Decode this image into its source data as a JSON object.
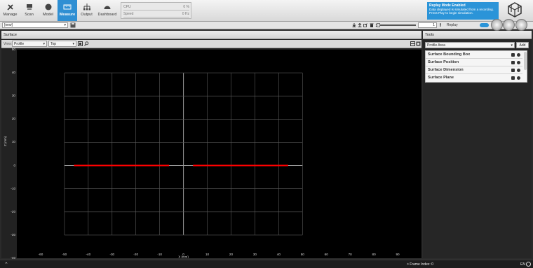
{
  "nav": [
    {
      "label": "Manage",
      "icon": "tools-icon"
    },
    {
      "label": "Scan",
      "icon": "scan-icon"
    },
    {
      "label": "Model",
      "icon": "model-icon"
    },
    {
      "label": "Measure",
      "icon": "measure-icon",
      "active": true
    },
    {
      "label": "Output",
      "icon": "output-icon"
    },
    {
      "label": "Dashboard",
      "icon": "dashboard-icon"
    }
  ],
  "stats": {
    "cpu_label": "CPU",
    "cpu_value": "0 %",
    "speed_label": "Speed",
    "speed_value": "0 Hz"
  },
  "replay_notice": {
    "title": "Replay Mode Enabled",
    "message": "Data displayed is simulated from a recording. Press Play to begin simulation."
  },
  "toolbar2": {
    "job": "[new]",
    "frame_value": "1",
    "replay_label": "Replay"
  },
  "surface": {
    "title": "Surface",
    "view_label": "View:",
    "view_mode": "Profile",
    "view_direction": "Top"
  },
  "tools": {
    "title": "Tools",
    "selected": "Profile Area",
    "add_label": "Add",
    "items": [
      "Surface Bounding Box",
      "Surface Position",
      "Surface Dimension",
      "Surface Plane"
    ]
  },
  "status": {
    "frame_index": "> Frame Index: 0",
    "language": "EN"
  },
  "colors": {
    "accent": "#2b94d8",
    "profile": "#ff0000"
  },
  "chart_data": {
    "type": "line",
    "title": "",
    "xlabel": "X (mm)",
    "ylabel": "Z (mm)",
    "xlim": [
      -70,
      100
    ],
    "ylim": [
      -40,
      50
    ],
    "x_ticks": [
      -60,
      -50,
      -40,
      -30,
      -20,
      -10,
      0,
      10,
      20,
      30,
      40,
      50,
      60,
      70,
      80,
      90
    ],
    "y_ticks": [
      50,
      40,
      30,
      20,
      10,
      0,
      -10,
      -20,
      -30,
      -40
    ],
    "grid_x": [
      -50,
      -40,
      -30,
      -20,
      -10,
      0,
      10,
      20,
      30,
      40,
      50
    ],
    "grid_y": [
      40,
      30,
      20,
      10,
      0,
      -10,
      -20,
      -30
    ],
    "series": [
      {
        "x": [
          -46,
          -6
        ],
        "y": [
          0,
          0
        ]
      },
      {
        "x": [
          4,
          44
        ],
        "y": [
          0,
          0
        ]
      }
    ]
  }
}
